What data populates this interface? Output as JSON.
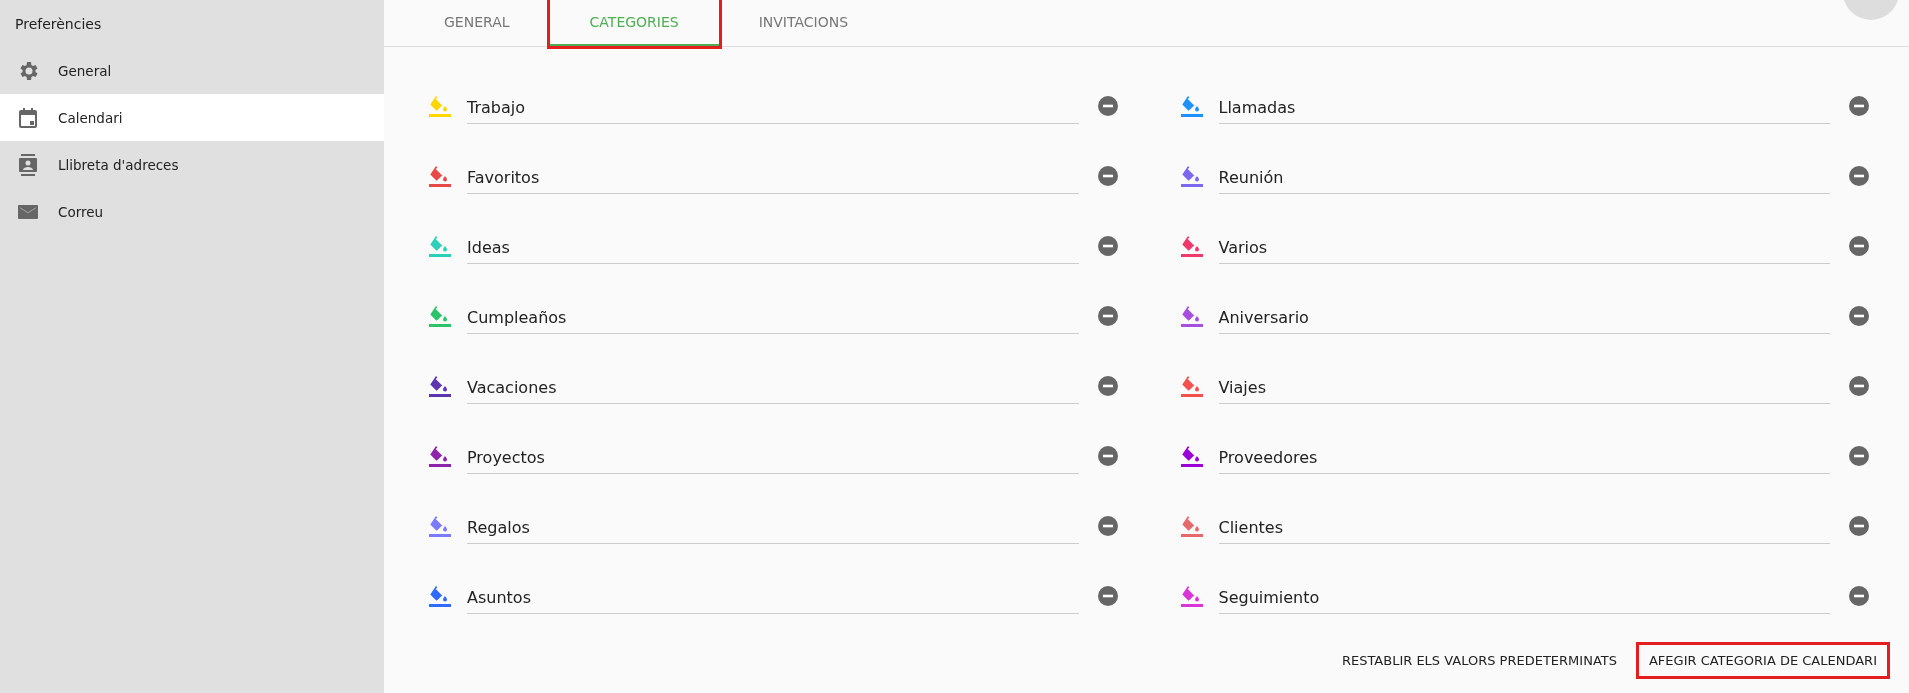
{
  "sidebar": {
    "title": "Preferències",
    "items": [
      {
        "label": "General",
        "kind": "gear",
        "selected": false
      },
      {
        "label": "Calendari",
        "kind": "calendar",
        "selected": true
      },
      {
        "label": "Llibreta d'adreces",
        "kind": "contact",
        "selected": false
      },
      {
        "label": "Correu",
        "kind": "mail",
        "selected": false
      }
    ]
  },
  "tabs": [
    {
      "label": "GENERAL",
      "selected": false,
      "highlighted": false
    },
    {
      "label": "CATEGORIES",
      "selected": true,
      "highlighted": true
    },
    {
      "label": "INVITACIONS",
      "selected": false,
      "highlighted": false
    }
  ],
  "categories": [
    {
      "name": "Trabajo",
      "color": "#ffd600"
    },
    {
      "name": "Llamadas",
      "color": "#1e90ff"
    },
    {
      "name": "Favoritos",
      "color": "#e84848"
    },
    {
      "name": "Reunión",
      "color": "#7b68ee"
    },
    {
      "name": "Ideas",
      "color": "#2ccfb8"
    },
    {
      "name": "Varios",
      "color": "#f0386b"
    },
    {
      "name": "Cumpleaños",
      "color": "#2ec26a"
    },
    {
      "name": "Aniversario",
      "color": "#a64ee0"
    },
    {
      "name": "Vacaciones",
      "color": "#5e35b1"
    },
    {
      "name": "Viajes",
      "color": "#f4504c"
    },
    {
      "name": "Proyectos",
      "color": "#8e24aa"
    },
    {
      "name": "Proveedores",
      "color": "#9c00d8"
    },
    {
      "name": "Regalos",
      "color": "#7b7bff"
    },
    {
      "name": "Clientes",
      "color": "#e8696b"
    },
    {
      "name": "Asuntos",
      "color": "#2f6bff"
    },
    {
      "name": "Seguimiento",
      "color": "#d936d9"
    }
  ],
  "buttons": [
    {
      "label": "RESTABLIR ELS VALORS PREDETERMINATS",
      "highlighted": false
    },
    {
      "label": "AFEGIR CATEGORIA DE CALENDARI",
      "highlighted": true
    }
  ]
}
